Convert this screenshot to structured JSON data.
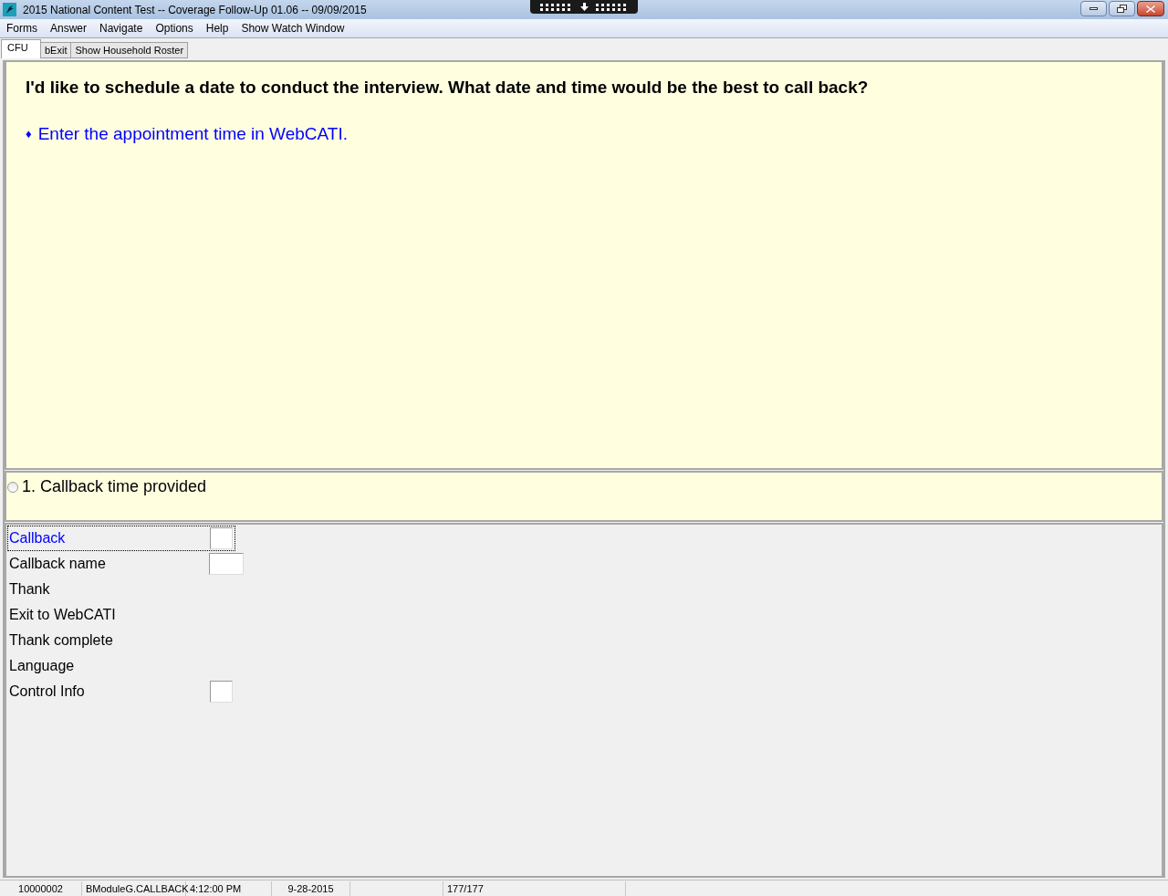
{
  "window": {
    "title": "2015 National Content Test -- Coverage Follow-Up 01.06 -- 09/09/2015"
  },
  "menu": [
    "Forms",
    "Answer",
    "Navigate",
    "Options",
    "Help",
    "Show Watch Window"
  ],
  "tabs": [
    {
      "label": "CFU",
      "selected": true
    },
    {
      "label": "bExit",
      "selected": false
    },
    {
      "label": "Show Household Roster",
      "selected": false
    }
  ],
  "question": {
    "text": "I'd like to schedule a date to conduct the interview. What date and time would be the best to call back?",
    "instruction_bullet": "♦",
    "instruction": "Enter the appointment time in WebCATI."
  },
  "answers": [
    {
      "label": "1. Callback time provided",
      "selected": false
    }
  ],
  "fields": [
    {
      "label": "Callback",
      "selected": true,
      "kind": "narrow"
    },
    {
      "label": "Callback name",
      "selected": false,
      "kind": "wide"
    },
    {
      "label": "Thank",
      "selected": false,
      "kind": "plain"
    },
    {
      "label": "Exit to WebCATI",
      "selected": false,
      "kind": "plain"
    },
    {
      "label": "Thank complete",
      "selected": false,
      "kind": "plain"
    },
    {
      "label": "Language",
      "selected": false,
      "kind": "plain"
    },
    {
      "label": "Control Info",
      "selected": false,
      "kind": "narrow"
    }
  ],
  "status_bar": [
    "10000002",
    "BModuleG.CALLBACK",
    "4:12:00 PM",
    "9-28-2015",
    "177/177"
  ]
}
